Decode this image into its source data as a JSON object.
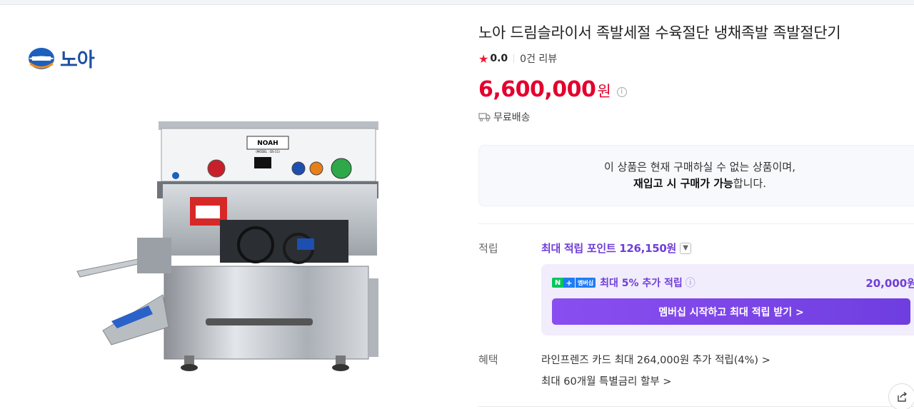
{
  "brand": {
    "name": "노아",
    "logo_icon": "noah-logo-icon"
  },
  "product": {
    "title": "노아 드림슬라이서 족발세절 수육절단 냉채족발 족발절단기",
    "rating_score": "0.0",
    "review_count": "0건 리뷰",
    "price": "6,600,000",
    "price_unit": "원",
    "price_info_icon": "ⓘ",
    "delivery": "무료배송"
  },
  "machine_labels": {
    "brand_plate": "NOAH",
    "model": "(MODEL : DS-11)"
  },
  "soldout": {
    "line1": "이 상품은 현재 구매하실 수 없는 상품이며,",
    "line2_bold": "재입고 시 구매가 가능",
    "line2_rest": "합니다."
  },
  "points": {
    "label": "적립",
    "headline": "최대 적립 포인트 126,150원",
    "member_badge_n": "N",
    "member_badge_plus": "+",
    "member_badge_text": "멤버십",
    "member_text": "최대 5% 추가 적립",
    "member_amount": "20,000원",
    "member_button": "멤버십 시작하고 최대 적립 받기 >"
  },
  "benefits": {
    "label": "혜택",
    "line1": "라인프렌즈 카드 최대 264,000원 추가 적립(4%) >",
    "line2": "최대 60개월 특별금리 할부 >"
  },
  "colors": {
    "price": "#e3002d",
    "accent_purple": "#6f3ed8",
    "member_bg": "#f1edfc",
    "star": "#f6162f"
  }
}
